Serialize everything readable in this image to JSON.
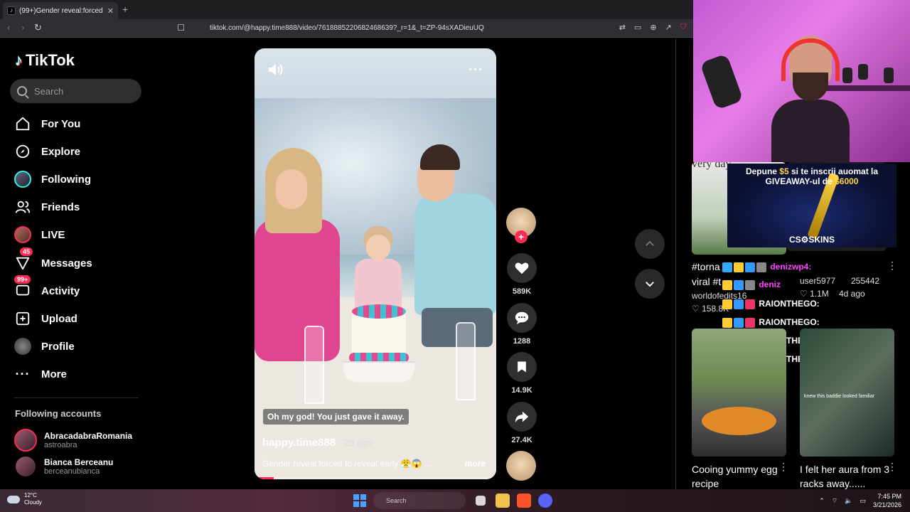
{
  "browser": {
    "tab_title": "(99+)Gender reveal:forced to",
    "tab_close": "✕",
    "new_tab": "+",
    "url": "tiktok.com/@happy.time888/video/7618885220682468639?_r=1&_t=ZP-94sXADieuUQ"
  },
  "sidebar": {
    "logo": "TikTok",
    "search_placeholder": "Search",
    "items": [
      {
        "label": "For You",
        "icon": "home-icon"
      },
      {
        "label": "Explore",
        "icon": "compass-icon"
      },
      {
        "label": "Following",
        "icon": "following-avatar-icon"
      },
      {
        "label": "Friends",
        "icon": "friends-icon"
      },
      {
        "label": "LIVE",
        "icon": "live-avatar-icon"
      },
      {
        "label": "Messages",
        "icon": "messages-icon",
        "badge": "45"
      },
      {
        "label": "Activity",
        "icon": "activity-icon",
        "badge": "99+"
      },
      {
        "label": "Upload",
        "icon": "upload-icon"
      },
      {
        "label": "Profile",
        "icon": "profile-avatar-icon"
      },
      {
        "label": "More",
        "icon": "more-icon"
      }
    ],
    "following_header": "Following accounts",
    "following": [
      {
        "name": "AbracadabraRomania",
        "handle": "astroabra"
      },
      {
        "name": "Bianca Berceanu",
        "handle": "berceanubianca"
      }
    ]
  },
  "video": {
    "subtitle": "Oh my god! You just gave it away.",
    "author": "happy.time888",
    "time": " · 2d ago",
    "description": "Gender reveal:forced to reveal early 😤😱 ...",
    "more": "more",
    "progress": 0.08
  },
  "actions": {
    "likes": "589K",
    "comments": "1288",
    "saves": "14.9K",
    "shares": "27.4K"
  },
  "overlay": {
    "promo_line1_a": "Depune ",
    "promo_amount1": "$5",
    "promo_line1_b": " si te inscrii auomat la",
    "promo_line2_a": "GIVEAWAY-ul de ",
    "promo_amount2": "$6000",
    "promo_brand": "CS⚙SKINS",
    "left_thumb_text": "very day",
    "left_title1": "#torna",
    "left_title2": "viral #t",
    "left_author": "worldofedits16",
    "left_likes": "158.8K",
    "right_author": "user5977",
    "right_id": "255442",
    "right_likes": "1.1M",
    "right_time": "4d ago",
    "chat": [
      "denizwp4:",
      "deniz",
      "RAIONTHEGO:",
      "RAIONTHEGO:",
      "RAIONTHEGO:",
      "RAIONTHEGO:"
    ],
    "bottom_left_title": "Cooing yummy egg recipe",
    "bottom_right_title": "I felt her aura from 3 racks away......",
    "bottom_right_thumb_text": "knew this baddie looked familiar"
  },
  "taskbar": {
    "temp": "12°C",
    "weather": "Cloudy",
    "search": "Search",
    "time": "7:45 PM",
    "date": "3/21/2026"
  }
}
